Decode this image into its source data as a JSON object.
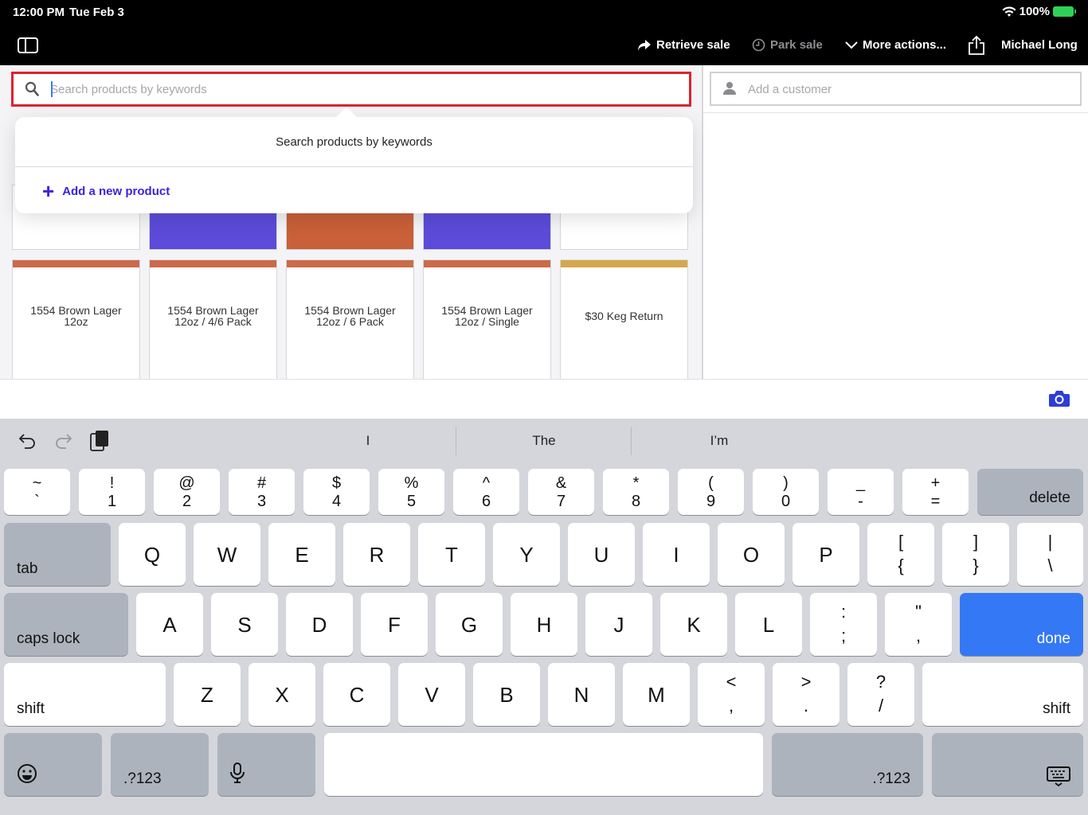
{
  "status": {
    "time": "12:00 PM",
    "date": "Tue Feb 3",
    "battery": "100%"
  },
  "nav": {
    "retrieve_sale": "Retrieve sale",
    "park_sale": "Park sale",
    "more_actions": "More actions...",
    "user": "Michael Long"
  },
  "search": {
    "placeholder": "Search products by keywords"
  },
  "customer": {
    "placeholder": "Add a customer"
  },
  "popover": {
    "title": "Search products by keywords",
    "add_product": "Add a new product"
  },
  "tiles_top": [
    {
      "color": "#ffffff"
    },
    {
      "color": "#5b4bd8"
    },
    {
      "color": "#c9603a"
    },
    {
      "color": "#5b4bd8"
    },
    {
      "color": "#ffffff"
    }
  ],
  "products": [
    {
      "name": "1554 Brown Lager 12oz",
      "color": "#cc6a4a"
    },
    {
      "name": "1554 Brown Lager 12oz / 4/6 Pack",
      "color": "#cc6a4a"
    },
    {
      "name": "1554 Brown Lager 12oz / 6 Pack",
      "color": "#cc6a4a"
    },
    {
      "name": "1554 Brown Lager 12oz / Single",
      "color": "#cc6a4a"
    },
    {
      "name": "$30 Keg Return",
      "color": "#d4a84c"
    }
  ],
  "keyboard": {
    "predictions": [
      "I",
      "The",
      "I’m"
    ],
    "row1": [
      [
        "~",
        "`"
      ],
      [
        "!",
        "1"
      ],
      [
        "@",
        "2"
      ],
      [
        "#",
        "3"
      ],
      [
        "$",
        "4"
      ],
      [
        "%",
        "5"
      ],
      [
        "^",
        "6"
      ],
      [
        "&",
        "7"
      ],
      [
        "*",
        "8"
      ],
      [
        "(",
        "9"
      ],
      [
        ")",
        "0"
      ],
      [
        "_",
        "-"
      ],
      [
        "+",
        "="
      ]
    ],
    "row2": [
      "Q",
      "W",
      "E",
      "R",
      "T",
      "Y",
      "U",
      "I",
      "O",
      "P"
    ],
    "row2_extra": [
      [
        "[",
        "{"
      ],
      [
        "]",
        "}"
      ],
      [
        "|",
        "\\"
      ]
    ],
    "row3": [
      "A",
      "S",
      "D",
      "F",
      "G",
      "H",
      "J",
      "K",
      "L"
    ],
    "row3_extra": [
      [
        ":",
        ";"
      ],
      [
        "\"",
        ","
      ]
    ],
    "row4": [
      "Z",
      "X",
      "C",
      "V",
      "B",
      "N",
      "M"
    ],
    "row4_extra": [
      [
        "<",
        ","
      ],
      [
        ">",
        "."
      ],
      [
        "?",
        "/"
      ]
    ],
    "delete": "delete",
    "tab": "tab",
    "caps_lock": "caps lock",
    "done": "done",
    "shift": "shift",
    "numbers": ".?123"
  }
}
